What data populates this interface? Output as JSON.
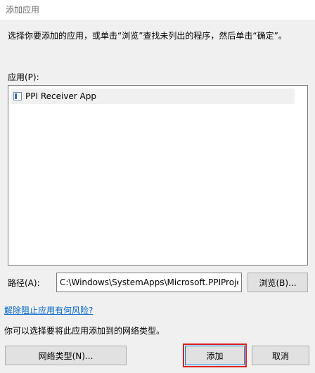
{
  "window": {
    "title": "添加应用"
  },
  "instructions": "选择你要添加的应用，或单击“浏览”查找未列出的程序，然后单击“确定”。",
  "apps": {
    "label": "应用(P):",
    "items": [
      {
        "label": "PPI Receiver App",
        "icon": "app-window-icon"
      }
    ]
  },
  "path": {
    "label": "路径(A):",
    "value": "C:\\Windows\\SystemApps\\Microsoft.PPIProje"
  },
  "buttons": {
    "browse": "浏览(B)...",
    "network_types": "网络类型(N)...",
    "add": "添加",
    "cancel": "取消"
  },
  "links": {
    "unblock_risk": "解除阻止应用有何风险?"
  },
  "network_text": "你可以选择要将此应用添加到的网络类型。",
  "colors": {
    "highlight": "#e0201e",
    "link": "#0066cc",
    "focus_border": "#0078d7"
  }
}
